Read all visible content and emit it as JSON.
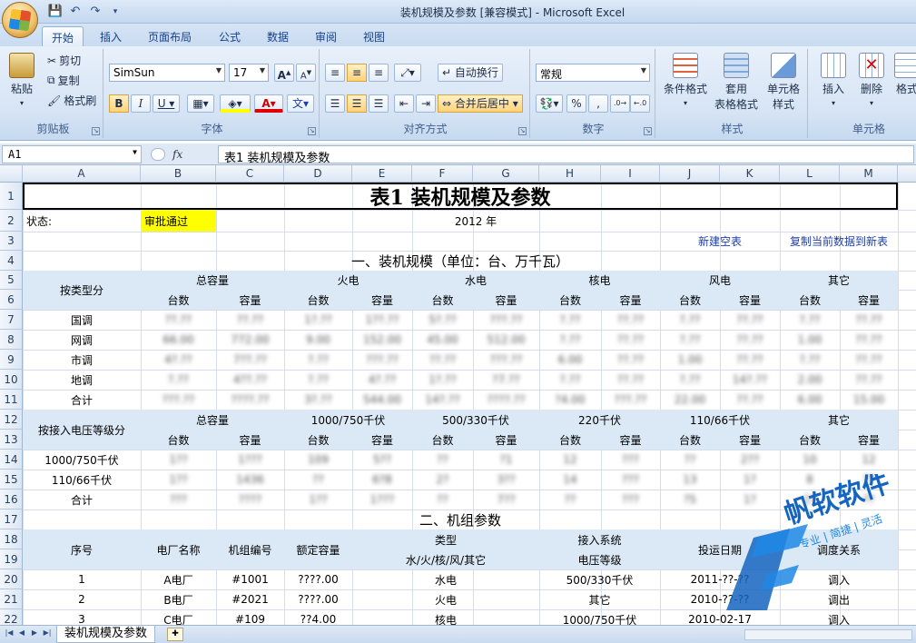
{
  "window": {
    "title": "装机规模及参数  [兼容模式] - Microsoft Excel"
  },
  "tabs": [
    "开始",
    "插入",
    "页面布局",
    "公式",
    "数据",
    "审阅",
    "视图"
  ],
  "ribbon": {
    "clipboard": {
      "label": "剪贴板",
      "paste": "粘贴",
      "cut": "剪切",
      "copy": "复制",
      "format_painter": "格式刷"
    },
    "font": {
      "label": "字体",
      "font_name": "SimSun",
      "font_size": "17"
    },
    "alignment": {
      "label": "对齐方式",
      "wrap_text": "自动换行",
      "merge_center": "合并后居中"
    },
    "number": {
      "label": "数字",
      "format": "常规"
    },
    "styles": {
      "label": "样式",
      "conditional": "条件格式",
      "table_format": "套用\n表格格式",
      "cell_styles": "单元格\n样式"
    },
    "cells": {
      "label": "单元格",
      "insert": "插入",
      "delete": "删除",
      "format": "格式"
    }
  },
  "formula_bar": {
    "name_box": "A1",
    "fx": "fx",
    "content": "表1 装机规模及参数"
  },
  "columns": [
    "A",
    "B",
    "C",
    "D",
    "E",
    "F",
    "G",
    "H",
    "I",
    "J",
    "K",
    "L",
    "M"
  ],
  "rows": [
    "1",
    "2",
    "3",
    "4",
    "5",
    "6",
    "7",
    "8",
    "9",
    "10",
    "11",
    "12",
    "13",
    "14",
    "15",
    "16",
    "17",
    "18",
    "19",
    "20",
    "21",
    "22"
  ],
  "sheet": {
    "title": "表1  装机规模及参数",
    "status_label": "状态:",
    "status_value": "审批通过",
    "year": "2012 年",
    "link_new": "新建空表",
    "link_copy": "复制当前数据到新表",
    "section1": "一、装机规模（单位：台、万千瓦）",
    "by_type": "按类型分",
    "by_voltage": "按接入电压等级分",
    "type_groups": [
      "总容量",
      "火电",
      "水电",
      "核电",
      "风电",
      "其它"
    ],
    "voltage_groups": [
      "总容量",
      "1000/750千伏",
      "500/330千伏",
      "220千伏",
      "110/66千伏",
      "其它"
    ],
    "sub_count": "台数",
    "sub_capacity": "容量",
    "type_rows": [
      {
        "name": "国调",
        "vals": [
          "??.??",
          "??.??",
          "1?.??",
          "1??.??",
          "5?.??",
          "???.??",
          "?.??",
          "??.??",
          "?.??",
          "??.??",
          "?.??",
          "??.??"
        ]
      },
      {
        "name": "网调",
        "vals": [
          "66.00",
          "772.00",
          "9.00",
          "152.00",
          "45.00",
          "512.00",
          "?.??",
          "??.??",
          "?.??",
          "??.??",
          "1.00",
          "??.??"
        ]
      },
      {
        "name": "市调",
        "vals": [
          "4?.??",
          "7??.??",
          "?.??",
          "???.??",
          "??.??",
          "???.??",
          "6.00",
          "??.??",
          "1.00",
          "??.??",
          "?.??",
          "??.??"
        ]
      },
      {
        "name": "地调",
        "vals": [
          "?.??",
          "4??.??",
          "?.??",
          "4?.??",
          "1?.??",
          "?7.??",
          "?.??",
          "??.??",
          "?.??",
          "14?.??",
          "2.00",
          "??.??"
        ]
      },
      {
        "name": "合计",
        "vals": [
          "???.??",
          "????.??",
          "3?.??",
          "544.00",
          "14?.??",
          "????.??",
          "?4.00",
          "???.??",
          "22.00",
          "??.??",
          "6.00",
          "15.00"
        ]
      }
    ],
    "voltage_rows": [
      {
        "name": "1000/750千伏",
        "vals": [
          "1??",
          "1???",
          "109",
          "5??",
          "??",
          "?1",
          "12",
          "???",
          "??",
          "2??",
          "10",
          "12"
        ]
      },
      {
        "name": "110/66千伏",
        "vals": [
          "1??",
          "1436",
          "??",
          "6?8",
          "2?",
          "3??",
          "14",
          "???",
          "13",
          "1?",
          "8",
          "??"
        ]
      },
      {
        "name": "合计",
        "vals": [
          "???",
          "????",
          "1??",
          "1???",
          "??",
          "7??",
          "??",
          "???",
          "?5",
          "1?",
          "1?",
          "??"
        ]
      }
    ],
    "section2": "二、机组参数",
    "unit_headers": {
      "seq": "序号",
      "plant": "电厂名称",
      "unit": "机组编号",
      "rated": "额定容量",
      "type": "类型",
      "type_sub": "水/火/核/风/其它",
      "grid": "接入系统",
      "grid_sub": "电压等级",
      "date": "投运日期",
      "dispatch": "调度关系"
    },
    "unit_rows": [
      {
        "seq": "1",
        "plant": "A电厂",
        "unit": "#1001",
        "rated": "????.00",
        "type": "水电",
        "voltage": "500/330千伏",
        "date": "2011-??-??",
        "dispatch": "调入"
      },
      {
        "seq": "2",
        "plant": "B电厂",
        "unit": "#2021",
        "rated": "????.00",
        "type": "火电",
        "voltage": "其它",
        "date": "2010-??-??",
        "dispatch": "调出"
      },
      {
        "seq": "3",
        "plant": "C电厂",
        "unit": "#109",
        "rated": "??4.00",
        "type": "核电",
        "voltage": "1000/750千伏",
        "date": "2010-02-17",
        "dispatch": "调入"
      }
    ],
    "sheet_tab": "装机规模及参数"
  },
  "watermark": {
    "brand": "帆软软件",
    "slogan": "专业 | 简捷 | 灵活"
  },
  "colors": {
    "accent": "#15428b",
    "status_fill": "#ffff00",
    "header_fill": "#dbe9f6",
    "link": "#1f3fa8"
  }
}
